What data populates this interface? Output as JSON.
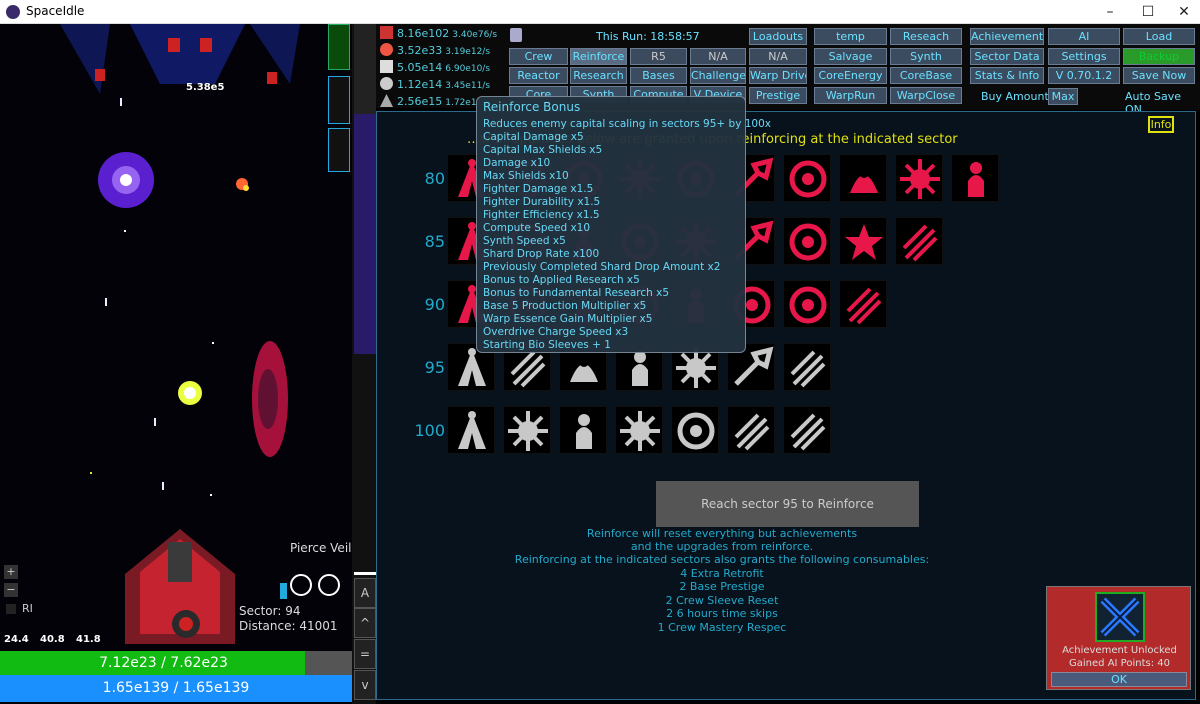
{
  "window": {
    "title": "SpaceIdle",
    "minimize": "–",
    "maximize": "☐",
    "close": "✕"
  },
  "game": {
    "damage_float": "5.38e5",
    "pierce_label": "Pierce Veil",
    "sector_label": "Sector: 94",
    "distance_label": "Distance: 41001",
    "ri_label": "RI",
    "stat1": "24.4",
    "stat2": "40.8",
    "stat3": "41.8",
    "zoom_in": "+",
    "zoom_out": "−",
    "hp_text": "7.12e23 / 7.62e23",
    "hp_fraction": 0.934,
    "shield_text": "1.65e139 / 1.65e139"
  },
  "strip": {
    "a": "A",
    "up": "^",
    "eq": "=",
    "down": "v"
  },
  "resources": [
    {
      "value": "8.16e102",
      "rate": "3.40e76/s",
      "icon": "ban-icon",
      "color": "#e33"
    },
    {
      "value": "3.52e33",
      "rate": "3.19e12/s",
      "icon": "circle-icon",
      "color": "#e54"
    },
    {
      "value": "5.05e14",
      "rate": "6.90e10/s",
      "icon": "dice-icon",
      "color": "#ddd"
    },
    {
      "value": "1.12e14",
      "rate": "3.45e11/s",
      "icon": "sphere-icon",
      "color": "#ccc"
    },
    {
      "value": "2.56e15",
      "rate": "1.72e11/s",
      "icon": "triangle-icon",
      "color": "#ccc"
    }
  ],
  "run_label": "This Run: 18:58:57",
  "buttons": {
    "crew": "Crew",
    "reinforce": "Reinforce",
    "r5": "R5",
    "na1": "N/A",
    "reactor": "Reactor",
    "research": "Research",
    "bases": "Bases",
    "challenges": "Challenges",
    "core": "Core",
    "synth": "Synth",
    "compute": "Compute",
    "vdevice": "V Device",
    "loadouts": "Loadouts",
    "na2": "N/A",
    "warpdrive": "Warp Drive",
    "prestige": "Prestige",
    "temp": "temp",
    "salvage": "Salvage",
    "coreenergy": "CoreEnergy",
    "warprun": "WarpRun",
    "reseach": "Reseach",
    "synth2": "Synth",
    "corebase": "CoreBase",
    "warpclose": "WarpClose",
    "achievements": "Achievements",
    "sectordata": "Sector Data",
    "statsinfo": "Stats & Info",
    "buy_amount": "Buy Amount:",
    "ai": "AI",
    "settings": "Settings",
    "version": "V 0.70.1.2",
    "max": "Max",
    "load": "Load",
    "backup": "Backup",
    "savenow": "Save Now",
    "autosave": "Auto Save ON"
  },
  "main": {
    "info": "Info",
    "subtitle": "…w of upgrades below are granted upon reinforcing at the indicated sector",
    "rows": [
      "80",
      "85",
      "90",
      "95",
      "100"
    ],
    "reach_button": "Reach sector 95 to Reinforce",
    "info_lines": [
      "Reinforce will reset everything but achievements",
      "and the upgrades from reinforce.",
      "Reinforcing at the indicated sectors also grants the following consumables:",
      "4 Extra Retrofit",
      "2 Base Prestige",
      "2 Crew Sleeve Reset",
      "2 6 hours time skips",
      "1 Crew Mastery Respec"
    ]
  },
  "tooltip": {
    "title": "Reinforce Bonus",
    "lines": [
      "Reduces enemy capital scaling in sectors 95+ by 100x",
      "Capital Damage x5",
      "Capital Max Shields x5",
      "Damage x10",
      "Max Shields x10",
      "Fighter Damage x1.5",
      "Fighter Durability x1.5",
      "Fighter Efficiency x1.5",
      "Compute Speed x10",
      "Synth Speed x5",
      "Shard Drop Rate x100",
      "Previously Completed Shard Drop Amount x2",
      "Bonus to Applied Research x5",
      "Bonus to Fundamental Research x5",
      "Base 5 Production Multiplier x5",
      "Warp Essence Gain Multiplier x5",
      "Overdrive Charge Speed x3",
      "Starting Bio Sleeves + 1"
    ]
  },
  "achievement": {
    "title": "Achievement Unlocked",
    "points": "Gained AI Points: 40",
    "ok": "OK"
  },
  "colors": {
    "accent": "#6ae0ff",
    "upgrade_red": "#e8174a",
    "upgrade_grey": "#c8c8c8"
  }
}
